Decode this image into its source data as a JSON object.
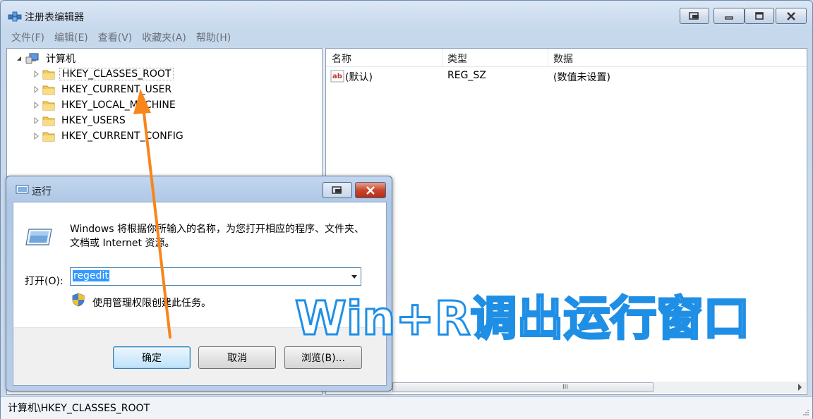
{
  "window": {
    "title": "注册表编辑器",
    "icon": "registry-editor-icon"
  },
  "menubar": {
    "items": [
      "文件(F)",
      "编辑(E)",
      "查看(V)",
      "收藏夹(A)",
      "帮助(H)"
    ]
  },
  "tree": {
    "root": "计算机",
    "items": [
      {
        "label": "HKEY_CLASSES_ROOT",
        "selected": true
      },
      {
        "label": "HKEY_CURRENT_USER"
      },
      {
        "label": "HKEY_LOCAL_MACHINE"
      },
      {
        "label": "HKEY_USERS"
      },
      {
        "label": "HKEY_CURRENT_CONFIG"
      }
    ]
  },
  "list": {
    "columns": [
      "名称",
      "类型",
      "数据"
    ],
    "rows": [
      {
        "name": "(默认)",
        "type": "REG_SZ",
        "data": "(数值未设置)"
      }
    ],
    "scroll_grip": "III"
  },
  "status": {
    "path": "计算机\\HKEY_CLASSES_ROOT"
  },
  "run_dialog": {
    "title": "运行",
    "description": "Windows 将根据你所输入的名称，为您打开相应的程序、文件夹、文档或 Internet 资源。",
    "open_label": "打开(O):",
    "open_value": "regedit",
    "admin_note": "使用管理权限创建此任务。",
    "buttons": {
      "ok": "确定",
      "cancel": "取消",
      "browse": "浏览(B)..."
    }
  },
  "annotation": {
    "caption": "Win+R调出运行窗口",
    "color": "#1f8fe6",
    "arrow_color": "#f7861c"
  }
}
